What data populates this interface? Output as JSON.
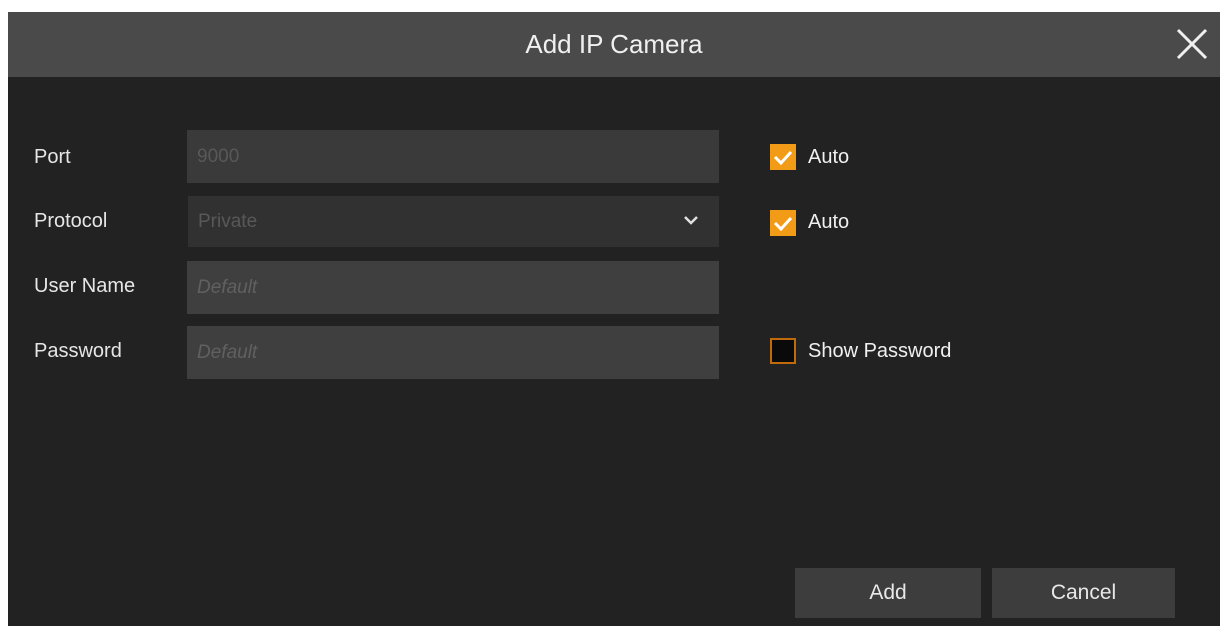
{
  "dialog": {
    "title": "Add IP Camera",
    "close_icon": "close-icon"
  },
  "form": {
    "port": {
      "label": "Port",
      "value": "9000",
      "auto_label": "Auto",
      "auto_checked": true
    },
    "protocol": {
      "label": "Protocol",
      "value": "Private",
      "auto_label": "Auto",
      "auto_checked": true,
      "icon": "chevron-down-icon"
    },
    "username": {
      "label": "User Name",
      "placeholder": "Default"
    },
    "password": {
      "label": "Password",
      "placeholder": "Default",
      "show_label": "Show Password",
      "show_checked": false
    }
  },
  "buttons": {
    "add": "Add",
    "cancel": "Cancel"
  },
  "colors": {
    "accent": "#f29b17",
    "background": "#222222",
    "titlebar": "#4a4a4a"
  }
}
